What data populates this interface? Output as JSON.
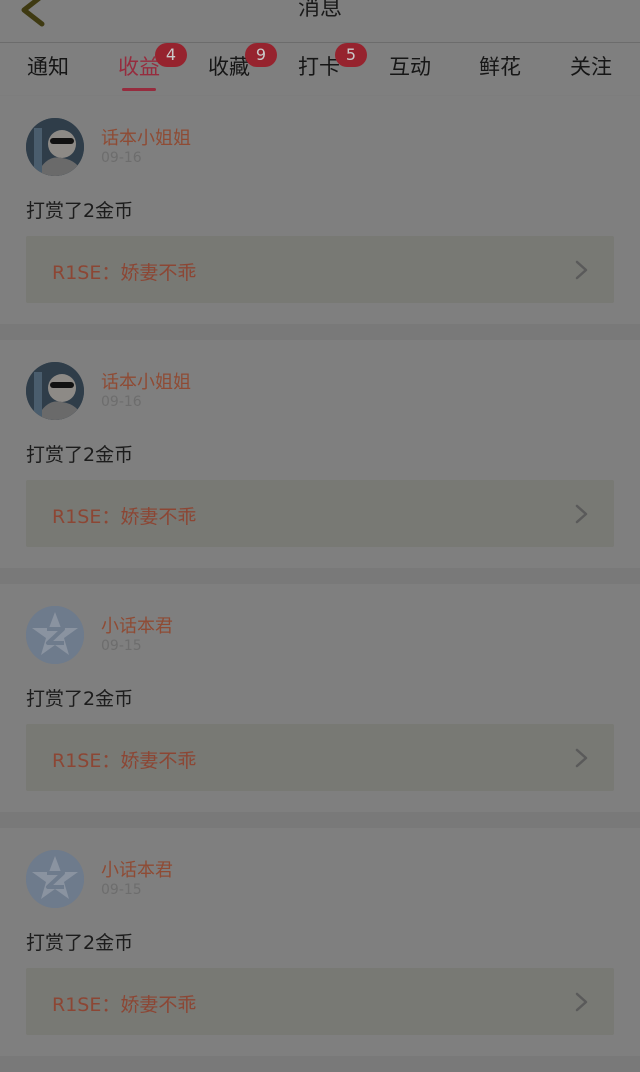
{
  "header": {
    "title": "消息"
  },
  "tabs": [
    {
      "label": "通知",
      "badge": ""
    },
    {
      "label": "收益",
      "badge": "4",
      "active": true
    },
    {
      "label": "收藏",
      "badge": "9"
    },
    {
      "label": "打卡",
      "badge": "5"
    },
    {
      "label": "互动",
      "badge": ""
    },
    {
      "label": "鲜花",
      "badge": ""
    },
    {
      "label": "关注",
      "badge": ""
    }
  ],
  "items": [
    {
      "name": "话本小姐姐",
      "date": "09-16",
      "message": "打赏了2金币",
      "link": "R1SE：娇妻不乖",
      "avatar": "photo"
    },
    {
      "name": "话本小姐姐",
      "date": "09-16",
      "message": "打赏了2金币",
      "link": "R1SE：娇妻不乖",
      "avatar": "photo"
    },
    {
      "name": "小话本君",
      "date": "09-15",
      "message": "打赏了2金币",
      "link": "R1SE：娇妻不乖",
      "avatar": "default"
    },
    {
      "name": "小话本君",
      "date": "09-15",
      "message": "打赏了2金币",
      "link": "R1SE：娇妻不乖",
      "avatar": "default"
    }
  ],
  "icons": {
    "back": "chevron-left-icon",
    "item_link": "chevron-right-icon",
    "default_avatar": "star-z-avatar-icon"
  },
  "colors": {
    "accent": "#962c3e",
    "badge": "#96232e",
    "username": "#8f4b34"
  }
}
